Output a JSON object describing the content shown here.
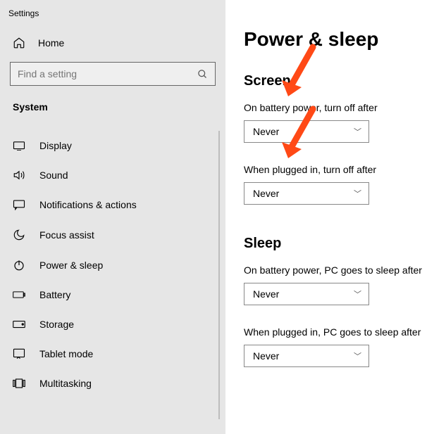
{
  "app": {
    "title": "Settings"
  },
  "sidebar": {
    "home_label": "Home",
    "search_placeholder": "Find a setting",
    "section": "System",
    "items": [
      {
        "label": "Display",
        "icon": "display-icon"
      },
      {
        "label": "Sound",
        "icon": "sound-icon"
      },
      {
        "label": "Notifications & actions",
        "icon": "notifications-icon"
      },
      {
        "label": "Focus assist",
        "icon": "focus-assist-icon"
      },
      {
        "label": "Power & sleep",
        "icon": "power-icon"
      },
      {
        "label": "Battery",
        "icon": "battery-icon"
      },
      {
        "label": "Storage",
        "icon": "storage-icon"
      },
      {
        "label": "Tablet mode",
        "icon": "tablet-icon"
      },
      {
        "label": "Multitasking",
        "icon": "multitasking-icon"
      }
    ]
  },
  "main": {
    "title": "Power & sleep",
    "screen": {
      "heading": "Screen",
      "battery_label": "On battery power, turn off after",
      "battery_value": "Never",
      "plugged_label": "When plugged in, turn off after",
      "plugged_value": "Never"
    },
    "sleep": {
      "heading": "Sleep",
      "battery_label": "On battery power, PC goes to sleep after",
      "battery_value": "Never",
      "plugged_label": "When plugged in, PC goes to sleep after",
      "plugged_value": "Never"
    }
  },
  "annotations": {
    "arrows": [
      {
        "target": "screen-battery-select",
        "color": "#ff4916"
      },
      {
        "target": "screen-plugged-select",
        "color": "#ff4916"
      }
    ]
  }
}
